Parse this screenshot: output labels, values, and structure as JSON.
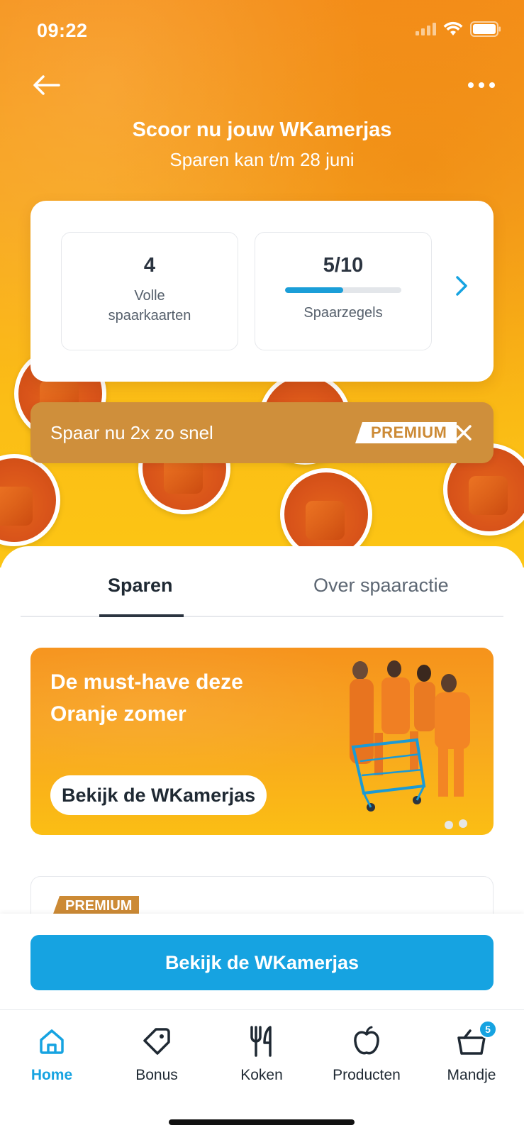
{
  "status_bar": {
    "time": "09:22"
  },
  "header": {
    "title": "Scoor nu jouw WKamerjas",
    "subtitle": "Sparen kan t/m 28 juni"
  },
  "stats": {
    "full_cards_value": "4",
    "full_cards_label": "Volle spaarkaarten",
    "stamps_value": "5/10",
    "stamps_label": "Spaarzegels",
    "stamps_progress": 0.5
  },
  "premium_banner": {
    "text": "Spaar nu 2x zo snel",
    "badge": "PREMIUM"
  },
  "tabs": {
    "sparen": "Sparen",
    "over": "Over spaaractie"
  },
  "promo": {
    "title": "De must-have deze Oranje zomer",
    "button": "Bekijk de WKamerjas"
  },
  "next_card": {
    "badge": "PREMIUM"
  },
  "cta": {
    "label": "Bekijk de WKamerjas"
  },
  "bottom_nav": {
    "home": "Home",
    "bonus": "Bonus",
    "koken": "Koken",
    "producten": "Producten",
    "mandje": "Mandje",
    "cart_count": "5"
  },
  "colors": {
    "accent_blue": "#16a3e1",
    "brand_orange": "#f6931b",
    "premium_gold": "#cc8a35"
  }
}
